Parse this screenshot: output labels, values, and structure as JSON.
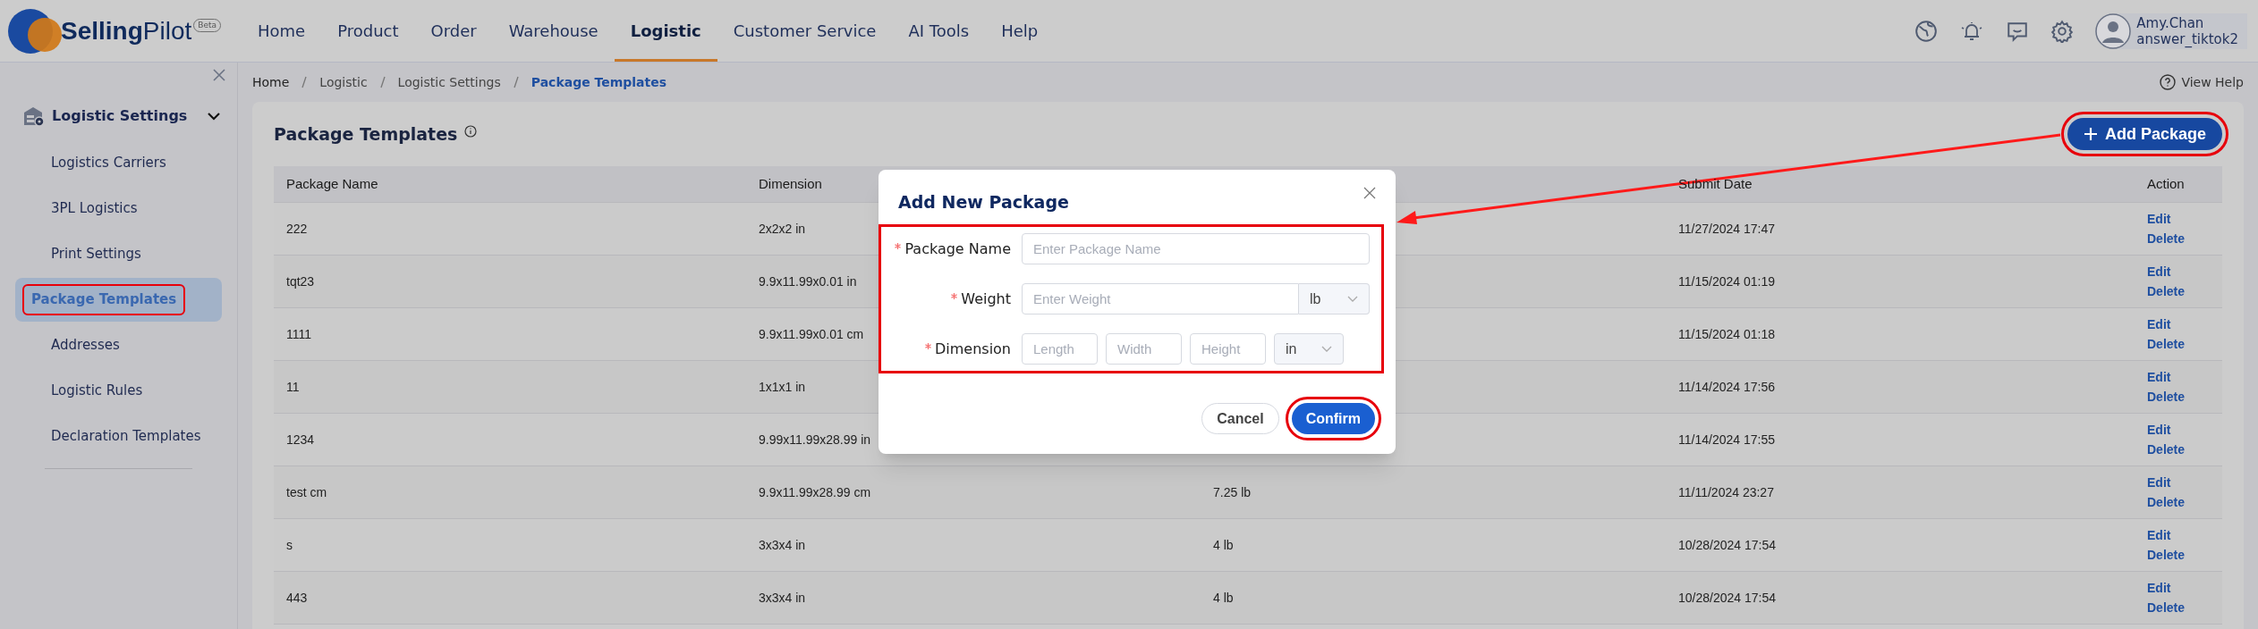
{
  "app": {
    "logo": "**Selling**Pilot",
    "badge": "Beta"
  },
  "nav": [
    {
      "label": "Home",
      "selected": false
    },
    {
      "label": "Product",
      "selected": false
    },
    {
      "label": "Order",
      "selected": false
    },
    {
      "label": "Warehouse",
      "selected": false
    },
    {
      "label": "Logistic",
      "selected": true
    },
    {
      "label": "Customer Service",
      "selected": false
    },
    {
      "label": "AI Tools",
      "selected": false
    },
    {
      "label": "Help",
      "selected": false
    }
  ],
  "user": {
    "name": "Amy.Chan",
    "account": "answer_tiktok2"
  },
  "sidebar": {
    "group": {
      "label": "Logistic Settings",
      "expanded": true,
      "items": [
        {
          "label": "Logistics Carriers",
          "selected": false,
          "highlighted": false
        },
        {
          "label": "3PL Logistics",
          "selected": false,
          "highlighted": false
        },
        {
          "label": "Print Settings",
          "selected": false,
          "highlighted": false
        },
        {
          "label": "Package Templates",
          "selected": true,
          "highlighted": true
        },
        {
          "label": "Addresses",
          "selected": false,
          "highlighted": false
        },
        {
          "label": "Logistic Rules",
          "selected": false,
          "highlighted": false
        },
        {
          "label": "Declaration Templates",
          "selected": false,
          "highlighted": false
        }
      ]
    }
  },
  "breadcrumb": [
    "Home",
    "Logistic",
    "Logistic Settings",
    "Package Templates"
  ],
  "help_link": "View Help",
  "page": {
    "title": "Package Templates",
    "add_button": {
      "label": "Add Package",
      "highlighted": true
    }
  },
  "table": {
    "columns": {
      "package_name": "Package Name",
      "dimension": "Dimension",
      "submit_date": "Submit Date",
      "action": "Action"
    },
    "rows": [
      {
        "package_name": "222",
        "dimension": "2x2x2 in",
        "submit_date": "11/27/2024 17:47",
        "actions": [
          "Edit",
          "Delete"
        ]
      },
      {
        "package_name": "tqt23",
        "dimension": "9.9x11.99x0.01 in",
        "submit_date": "11/15/2024 01:19",
        "actions": [
          "Edit",
          "Delete"
        ]
      },
      {
        "package_name": "1111",
        "dimension": "9.9x11.99x0.01 cm",
        "submit_date": "11/15/2024 01:18",
        "actions": [
          "Edit",
          "Delete"
        ]
      },
      {
        "package_name": "11",
        "dimension": "1x1x1 in",
        "submit_date": "11/14/2024 17:56",
        "actions": [
          "Edit",
          "Delete"
        ]
      },
      {
        "package_name": "1234",
        "dimension": "9.99x11.99x28.99 in",
        "submit_date": "11/14/2024 17:55",
        "actions": [
          "Edit",
          "Delete"
        ]
      },
      {
        "package_name": "test cm",
        "dimension": "9.9x11.99x28.99 cm",
        "column_3": "7.25 lb",
        "submit_date": "11/11/2024 23:27",
        "actions": [
          "Edit",
          "Delete"
        ]
      },
      {
        "package_name": "s",
        "dimension": "3x3x4 in",
        "column_3": "4 lb",
        "submit_date": "10/28/2024 17:54",
        "actions": [
          "Edit",
          "Delete"
        ]
      },
      {
        "package_name": "443",
        "dimension": "3x3x4 in",
        "column_3": "4 lb",
        "submit_date": "10/28/2024 17:54",
        "actions": [
          "Edit",
          "Delete"
        ]
      }
    ]
  },
  "modal": {
    "title": "Add New Package",
    "form_highlighted": true,
    "fields": [
      {
        "kind": "text",
        "label": "Package Name",
        "required": true,
        "placeholder": "Enter Package Name"
      },
      {
        "kind": "unit",
        "label": "Weight",
        "required": true,
        "placeholder": "Enter Weight",
        "unit": "lb"
      },
      {
        "kind": "dimensions",
        "label": "Dimension",
        "required": true,
        "placeholders": [
          "Length",
          "Width",
          "Height"
        ],
        "unit": "in"
      }
    ],
    "buttons": [
      {
        "label": "Cancel",
        "kind": "secondary",
        "highlighted": false
      },
      {
        "label": "Confirm",
        "kind": "primary",
        "highlighted": true
      }
    ]
  }
}
